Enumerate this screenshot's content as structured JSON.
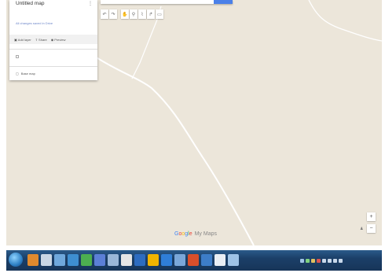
{
  "map": {
    "title": "Untitled map",
    "saved_status": "All changes saved in Drive"
  },
  "actions": {
    "add_layer": "Add layer",
    "share": "Share",
    "preview": "Preview"
  },
  "layers": {
    "base_map": "Base map"
  },
  "toolbar": {
    "icons": [
      "undo-icon",
      "redo-icon",
      "hand-icon",
      "marker-icon",
      "draw-line-icon",
      "directions-icon",
      "ruler-icon"
    ]
  },
  "zoom": {
    "in": "+",
    "out": "−"
  },
  "logo": {
    "my_maps": "My Maps"
  },
  "colors": {
    "map_background": "#ece6da",
    "road": "#ffffff",
    "accent_blue": "#4a80e8",
    "taskbar": "#1b3f68"
  }
}
